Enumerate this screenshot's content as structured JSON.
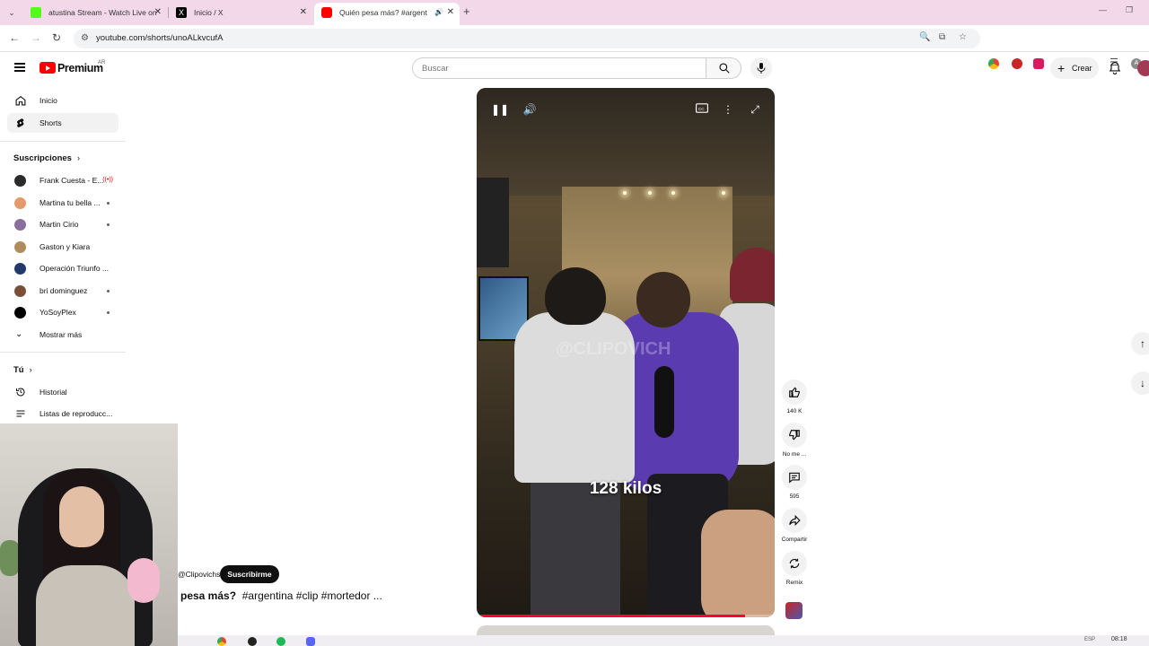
{
  "browser": {
    "tabs": [
      {
        "title": "atustina Stream - Watch Live on",
        "favicon_color": "#53fc18"
      },
      {
        "title": "Inicio / X",
        "favicon_color": "#000000"
      },
      {
        "title": "Quién pesa más? #argentin",
        "favicon_color": "#ff0000",
        "active": true
      }
    ],
    "new_tab": "+",
    "url": "youtube.com/shorts/unoALkvcufA"
  },
  "youtube": {
    "brand": "Premium",
    "region": "AR",
    "search_placeholder": "Buscar",
    "create_label": "Crear"
  },
  "sidebar": {
    "main_items": [
      {
        "label": "Inicio",
        "icon": "home-icon"
      },
      {
        "label": "Shorts",
        "icon": "shorts-icon",
        "active": true
      }
    ],
    "subscriptions_heading": "Suscripciones",
    "subscriptions": [
      {
        "label": "Frank Cuesta - E...",
        "avatar_color": "#2b2b2b",
        "live": true
      },
      {
        "label": "Martina tu bella ...",
        "avatar_color": "#e49a6a",
        "dot": true
      },
      {
        "label": "Martin Cirio",
        "avatar_color": "#8a6f9c",
        "dot": true
      },
      {
        "label": "Gaston y Kiara",
        "avatar_color": "#b08c5c"
      },
      {
        "label": "Operación Triunfo ...",
        "avatar_color": "#223a6b"
      },
      {
        "label": "bri dominguez",
        "avatar_color": "#7a4f3a",
        "dot": true
      },
      {
        "label": "YoSoyPlex",
        "avatar_color": "#000000",
        "dot": true
      }
    ],
    "show_more": "Mostrar más",
    "you_heading": "Tú",
    "you_items": [
      {
        "label": "Historial",
        "icon": "history-icon"
      },
      {
        "label": "Listas de reproducc...",
        "icon": "playlist-icon"
      }
    ]
  },
  "video": {
    "caption": "128 kilos",
    "watermark": "@CLIPOVICH",
    "progress_fraction": 0.9,
    "channel": "@Clipovichs",
    "subscribe_label": "Suscribirme",
    "title_prefix": "pesa más?",
    "title_tags": "#argentina #clip #mortedor ..."
  },
  "actions": {
    "like_count": "140 K",
    "dislike_label": "No me ...",
    "comments_count": "595",
    "share_label": "Compartir",
    "remix_label": "Remix"
  },
  "taskbar": {
    "lang": "ESP",
    "time": "08:18"
  },
  "colors": {
    "accent_red": "#ff0000",
    "tabbar_bg": "#f3d8ea"
  }
}
